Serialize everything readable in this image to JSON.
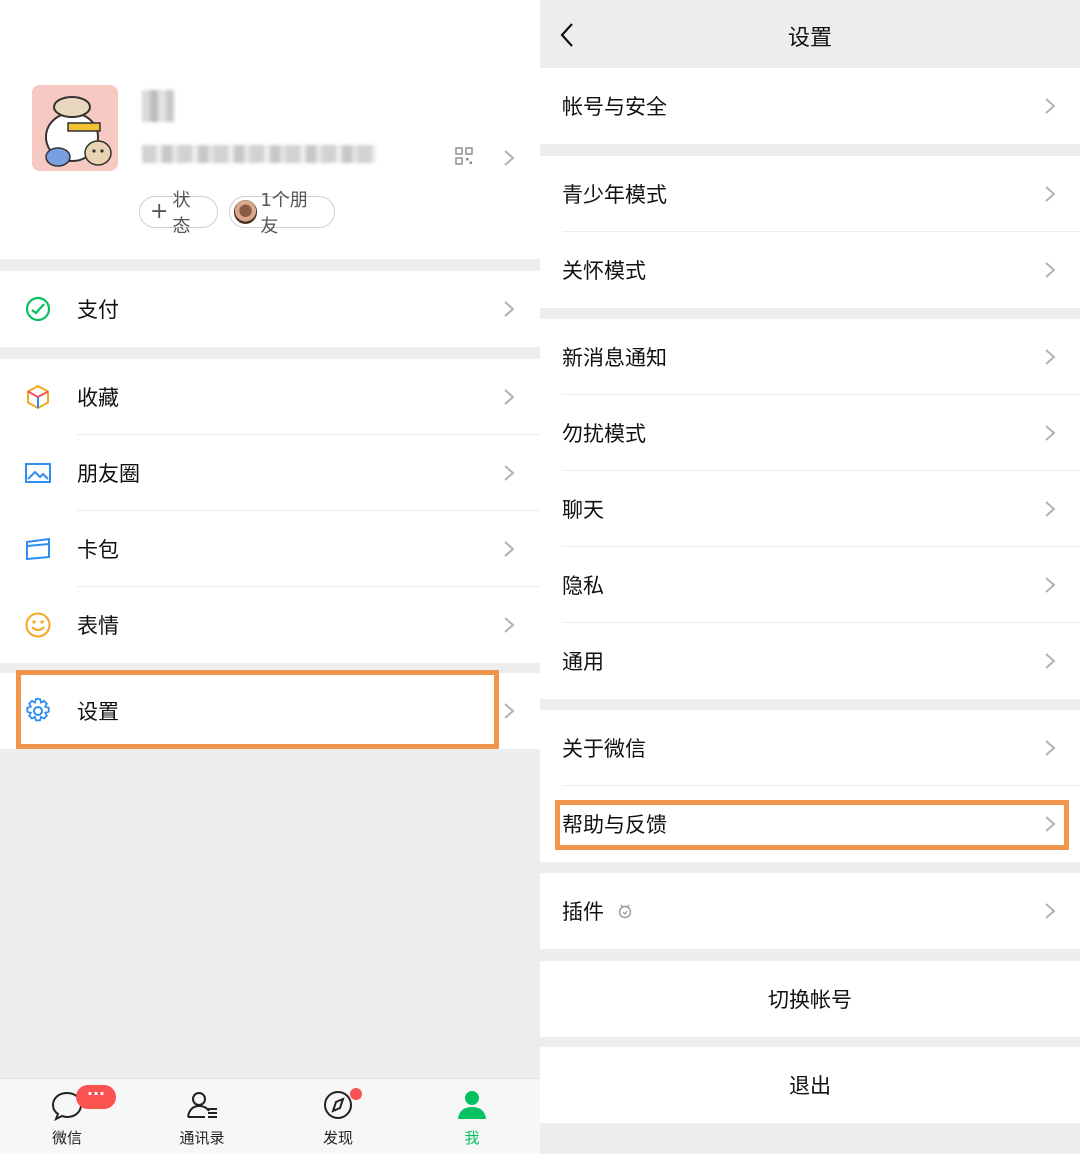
{
  "me_page": {
    "chips": {
      "status": "状态",
      "friends": "1个朋友"
    },
    "groups": [
      {
        "items": [
          {
            "icon": "pay-icon",
            "label": "支付"
          }
        ]
      },
      {
        "items": [
          {
            "icon": "favorites-icon",
            "label": "收藏"
          },
          {
            "icon": "moments-icon",
            "label": "朋友圈"
          },
          {
            "icon": "card-wallet-icon",
            "label": "卡包"
          },
          {
            "icon": "sticker-icon",
            "label": "表情"
          }
        ]
      },
      {
        "items": [
          {
            "icon": "settings-gear-icon",
            "label": "设置"
          }
        ]
      }
    ],
    "tabs": [
      {
        "icon": "chat-bubble-icon",
        "label": "微信",
        "badge": "···"
      },
      {
        "icon": "contacts-icon",
        "label": "通讯录"
      },
      {
        "icon": "compass-icon",
        "label": "发现"
      },
      {
        "icon": "person-icon",
        "label": "我",
        "active": true
      }
    ]
  },
  "settings_page": {
    "title": "设置",
    "groups": [
      [
        "帐号与安全"
      ],
      [
        "青少年模式",
        "关怀模式"
      ],
      [
        "新消息通知",
        "勿扰模式",
        "聊天",
        "隐私",
        "通用"
      ],
      [
        "关于微信",
        "帮助与反馈"
      ],
      [
        "插件"
      ]
    ],
    "switch_account": "切换帐号",
    "logout": "退出"
  },
  "colors": {
    "accent_green": "#07c160",
    "highlight_orange": "#f0954a",
    "badge_red": "#fa5151",
    "page_bg": "#ededed"
  }
}
